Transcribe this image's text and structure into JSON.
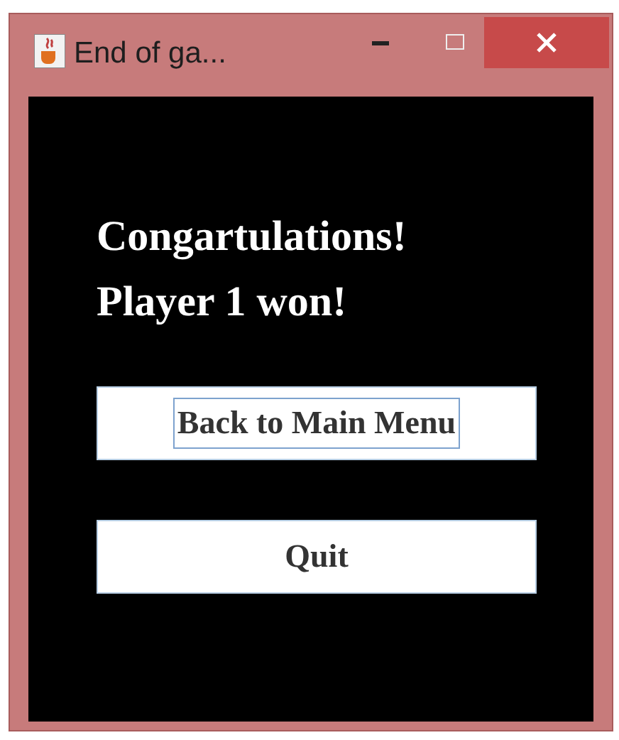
{
  "window": {
    "title": "End of ga..."
  },
  "message": [
    "Congartulations!",
    "Player 1 won!"
  ],
  "buttons": [
    {
      "label": "Back to Main Menu",
      "focused": true
    },
    {
      "label": "Quit",
      "focused": false
    }
  ]
}
